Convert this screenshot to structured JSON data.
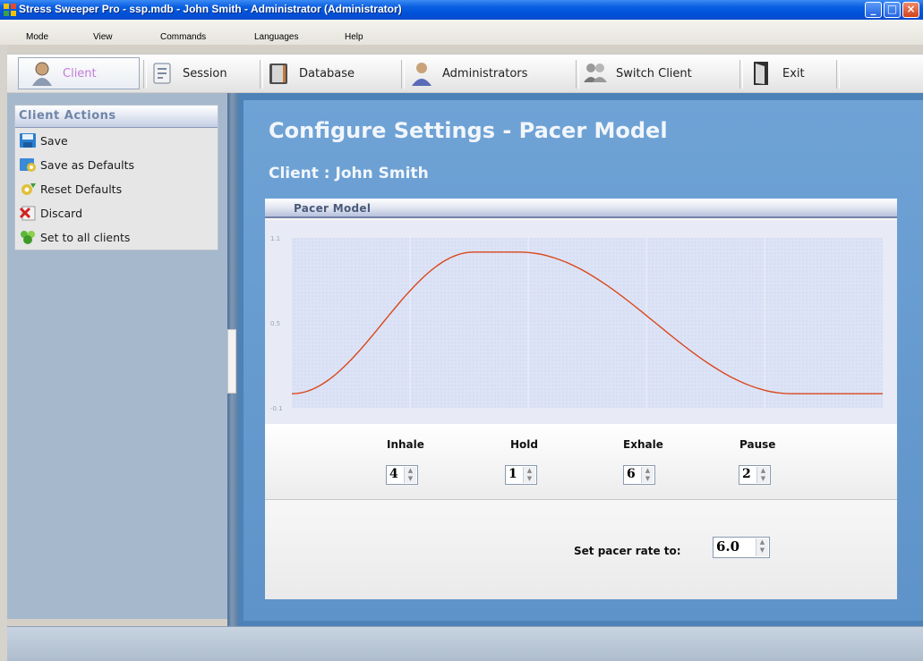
{
  "window": {
    "title": "Stress Sweeper Pro - ssp.mdb - John Smith - Administrator  (Administrator)"
  },
  "menu": [
    "Mode",
    "View",
    "Commands",
    "Languages",
    "Help"
  ],
  "toolbar": [
    {
      "label": "Client",
      "icon": "client-icon",
      "active": true
    },
    {
      "label": "Session",
      "icon": "session-icon"
    },
    {
      "label": "Database",
      "icon": "database-icon"
    },
    {
      "label": "Administrators",
      "icon": "administrators-icon"
    },
    {
      "label": "Switch Client",
      "icon": "switch-client-icon"
    },
    {
      "label": "Exit",
      "icon": "exit-door-icon"
    }
  ],
  "client_actions": {
    "title": "Client Actions",
    "items": [
      {
        "label": "Save",
        "icon": "save-icon"
      },
      {
        "label": "Save as Defaults",
        "icon": "save-defaults-icon"
      },
      {
        "label": "Reset Defaults",
        "icon": "reset-defaults-icon"
      },
      {
        "label": "Discard",
        "icon": "discard-icon"
      },
      {
        "label": "Set to all clients",
        "icon": "set-all-clients-icon"
      }
    ]
  },
  "main": {
    "heading": "Configure Settings - Pacer Model",
    "client_line": "Client : John Smith",
    "panel_title": "Pacer Model",
    "controls": [
      {
        "label": "Inhale",
        "value": "4"
      },
      {
        "label": "Hold",
        "value": "1"
      },
      {
        "label": "Exhale",
        "value": "6"
      },
      {
        "label": "Pause",
        "value": "2"
      }
    ],
    "rate_label": "Set pacer rate to:",
    "rate_value": "6.0"
  },
  "chart_data": {
    "type": "line",
    "title": "",
    "y_ticks": [
      "1.1",
      "0.5",
      "-0.1"
    ],
    "ylim": [
      -0.1,
      1.1
    ],
    "xlim": [
      0,
      13
    ],
    "series": [
      {
        "color": "#d9481c",
        "x": [
          0,
          4,
          5,
          11,
          13
        ],
        "y": [
          0.0,
          1.0,
          1.0,
          0.0,
          0.0
        ],
        "segments": [
          "sine-rise",
          "flat",
          "sine-fall",
          "flat"
        ]
      }
    ],
    "grid": true,
    "plot_background": "#dfe4f7",
    "line_color": "#d9481c"
  }
}
